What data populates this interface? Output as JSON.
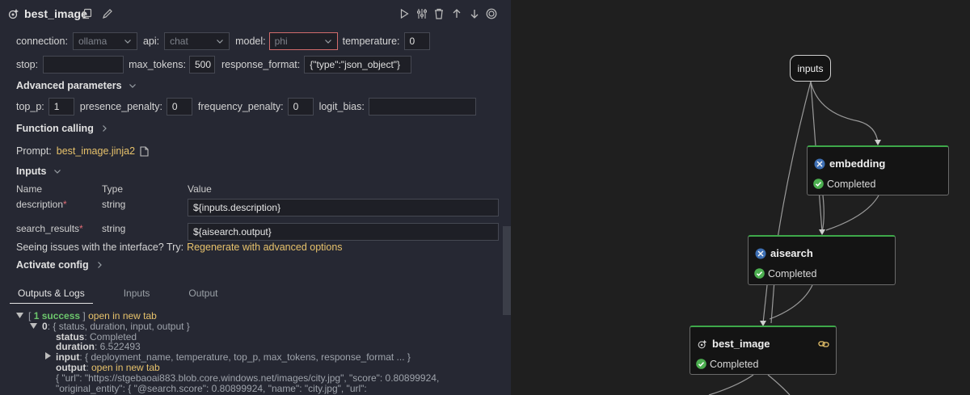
{
  "panel": {
    "title": "best_image",
    "colors": {
      "accent": "#e7c26b",
      "success": "#6cc66c",
      "error_border": "#d16b6b",
      "node_border_top": "#3ea84a"
    }
  },
  "params": {
    "connection_label": "connection:",
    "connection_value": "ollama",
    "api_label": "api:",
    "api_value": "chat",
    "model_label": "model:",
    "model_value": "phi",
    "temperature_label": "temperature:",
    "temperature_value": "0",
    "stop_label": "stop:",
    "stop_value": "",
    "max_tokens_label": "max_tokens:",
    "max_tokens_value": "500",
    "response_format_label": "response_format:",
    "response_format_value": "{\"type\":\"json_object\"}"
  },
  "advanced": {
    "title": "Advanced parameters",
    "top_p_label": "top_p:",
    "top_p_value": "1",
    "presence_penalty_label": "presence_penalty:",
    "presence_penalty_value": "0",
    "frequency_penalty_label": "frequency_penalty:",
    "frequency_penalty_value": "0",
    "logit_bias_label": "logit_bias:",
    "logit_bias_value": ""
  },
  "function_calling": {
    "title": "Function calling"
  },
  "prompt": {
    "label": "Prompt:",
    "file": "best_image.jinja2"
  },
  "inputs_section": {
    "title": "Inputs",
    "headers": [
      "Name",
      "Type",
      "Value"
    ],
    "rows": [
      {
        "name": "description",
        "required": "*",
        "type": "string",
        "value": "${inputs.description}"
      },
      {
        "name": "search_results",
        "required": "*",
        "type": "string",
        "value": "${aisearch.output}"
      }
    ]
  },
  "issues": {
    "text": "Seeing issues with the interface? Try:",
    "link": "Regenerate with advanced options"
  },
  "activate": {
    "title": "Activate config"
  },
  "tabs": [
    {
      "label": "Outputs & Logs",
      "active": true
    },
    {
      "label": "Inputs",
      "active": false
    },
    {
      "label": "Output",
      "active": false
    }
  ],
  "logs": {
    "bracket_open": "[",
    "success": "1 success",
    "bracket_close": "]",
    "open_new_tab": "open in new tab",
    "item0_key": "0",
    "item0_summary": ": { status, duration, input, output }",
    "status_key": "status",
    "status_value": ": Completed",
    "duration_key": "duration",
    "duration_value": ": 6.522493",
    "input_key": "input",
    "input_summary": ": { deployment_name, temperature, top_p, max_tokens, response_format ... }",
    "output_key": "output",
    "output_sep": ":",
    "output_line1": "{ \"url\": \"https://stgebaoai883.blob.core.windows.net/images/city.jpg\", \"score\": 0.80899924,",
    "output_line2": "\"original_entity\": { \"@search.score\": 0.80899924, \"name\": \"city.jpg\", \"url\":"
  },
  "graph": {
    "inputs_label": "inputs",
    "nodes": [
      {
        "title": "embedding",
        "status": "Completed",
        "icon": "python-icon"
      },
      {
        "title": "aisearch",
        "status": "Completed",
        "icon": "python-icon"
      },
      {
        "title": "best_image",
        "status": "Completed",
        "icon": "llm-icon"
      }
    ]
  }
}
